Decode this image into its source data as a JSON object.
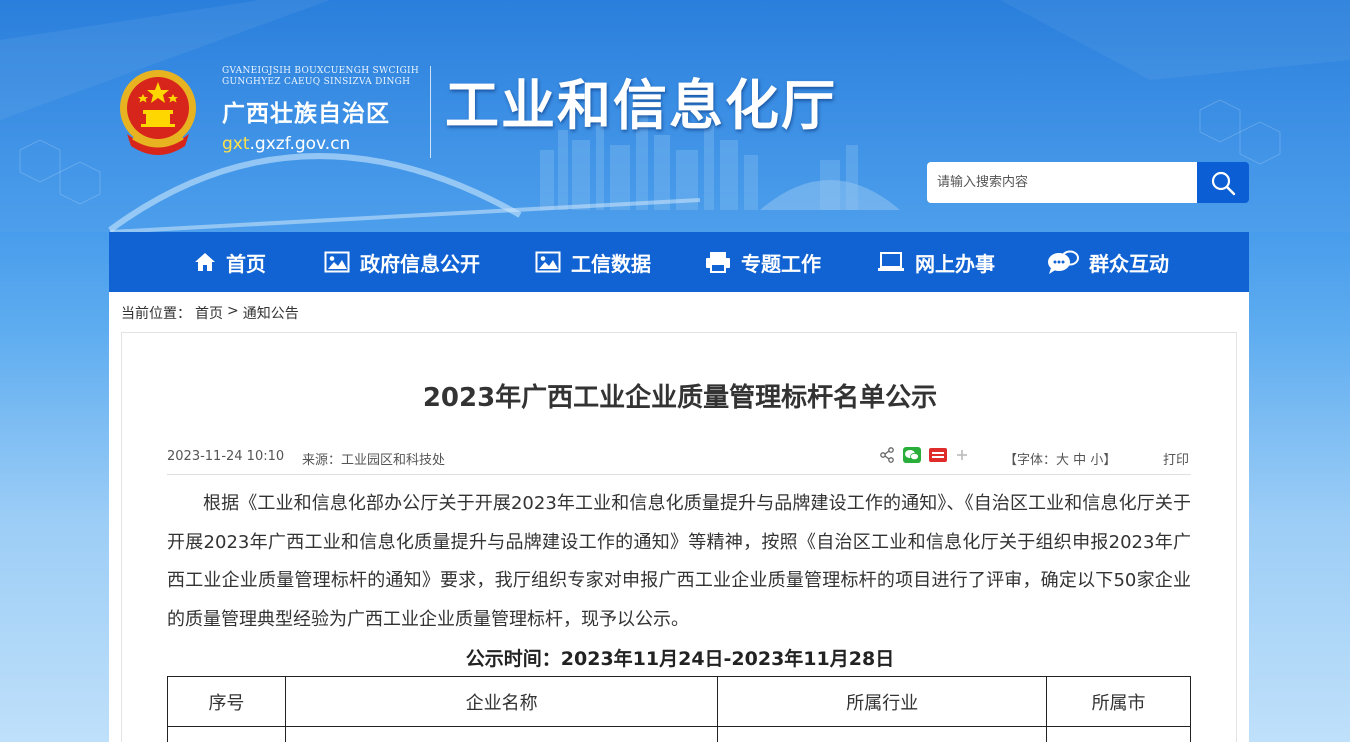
{
  "header": {
    "region_latin_line1": "GVANEIGJSIH BOUXCUENGH SWCIGIH",
    "region_latin_line2": "GUNGHYEZ CAEUQ SINSIZVA DINGH",
    "region_name": "广西壮族自治区",
    "domain_highlight": "gxt",
    "domain_rest": ".gxzf.gov.cn",
    "dept_title": "工业和信息化厅"
  },
  "search": {
    "placeholder": "请输入搜索内容"
  },
  "nav": {
    "items": [
      {
        "label": "首页",
        "icon": "home-icon"
      },
      {
        "label": "政府信息公开",
        "icon": "image-icon"
      },
      {
        "label": "工信数据",
        "icon": "image-icon"
      },
      {
        "label": "专题工作",
        "icon": "printer-icon"
      },
      {
        "label": "网上办事",
        "icon": "laptop-icon"
      },
      {
        "label": "群众互动",
        "icon": "chat-icon"
      }
    ]
  },
  "breadcrumb": {
    "prefix": "当前位置：",
    "home": "首页",
    "separator": ">",
    "current": "通知公告"
  },
  "article": {
    "title": "2023年广西工业企业质量管理标杆名单公示",
    "date": "2023-11-24 10:10",
    "source": "来源：工业园区和科技处",
    "font_label_prefix": "【字体：",
    "font_large": "大",
    "font_medium": "中",
    "font_small": "小",
    "font_label_suffix": "】",
    "print_label": "打印",
    "body": "根据《工业和信息化部办公厅关于开展2023年工业和信息化质量提升与品牌建设工作的通知》、《自治区工业和信息化厅关于开展2023年广西工业和信息化质量提升与品牌建设工作的通知》等精神，按照《自治区工业和信息化厅关于组织申报2023年广西工业企业质量管理标杆的通知》要求，我厅组织专家对申报广西工业企业质量管理标杆的项目进行了评审，确定以下50家企业的质量管理典型经验为广西工业企业质量管理标杆，现予以公示。",
    "period": "公示时间：2023年11月24日-2023年11月28日",
    "table_headers": [
      "序号",
      "企业名称",
      "所属行业",
      "所属市"
    ]
  },
  "colors": {
    "nav_bg": "#1163d3",
    "search_btn": "#0b5ed4",
    "domain_highlight": "#ffe14a"
  }
}
